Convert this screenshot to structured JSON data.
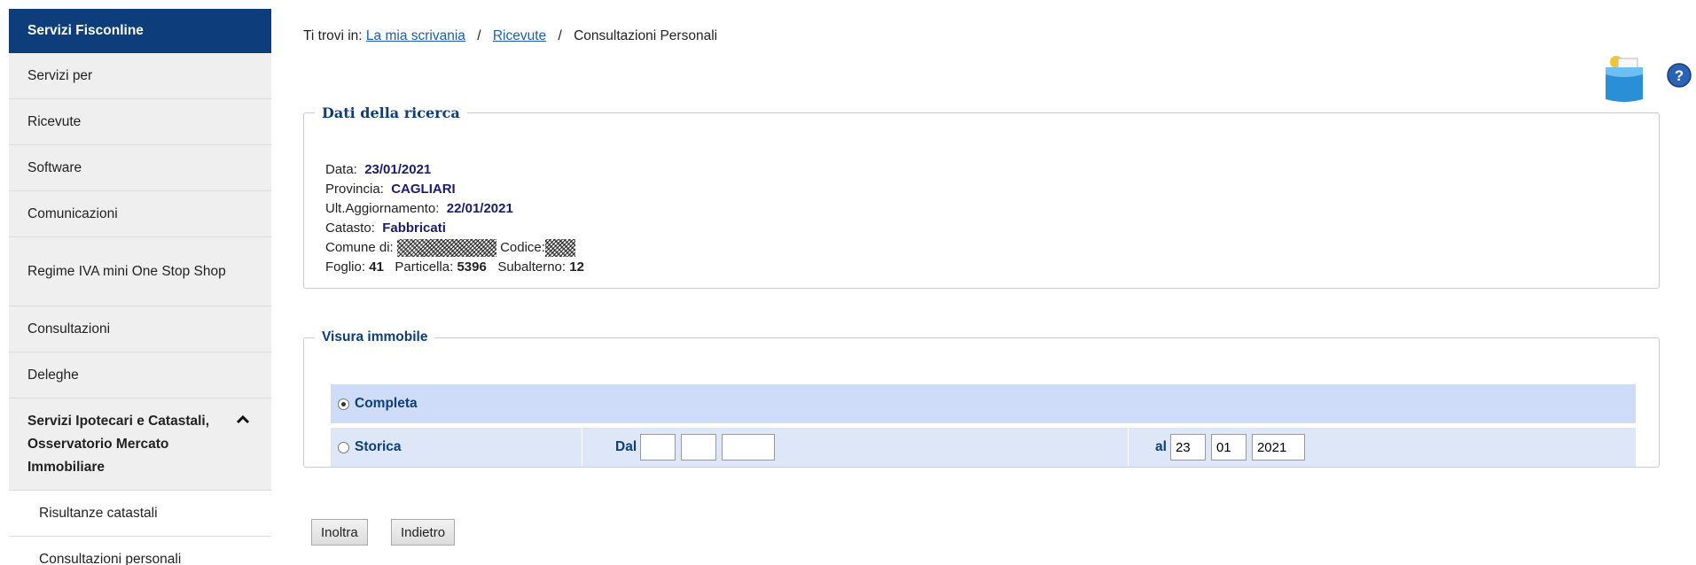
{
  "sidebar": {
    "header": "Servizi Fisconline",
    "items": [
      "Servizi per",
      "Ricevute",
      "Software",
      "Comunicazioni",
      "Regime IVA mini One Stop Shop",
      "Consultazioni",
      "Deleghe"
    ],
    "expanded_section": "Servizi Ipotecari e Catastali, Osservatorio Mercato Immobiliare",
    "sub_items": [
      "Risultanze catastali",
      "Consultazioni personali"
    ]
  },
  "breadcrumb": {
    "prefix": "Ti trovi in:",
    "links": [
      "La mia scrivania",
      "Ricevute"
    ],
    "separator": "/",
    "current": "Consultazioni Personali"
  },
  "ricerca": {
    "legend": "Dati della ricerca",
    "data_label": "Data:",
    "data_value": "23/01/2021",
    "provincia_label": "Provincia:",
    "provincia_value": "CAGLIARI",
    "agg_label": "Ult.Aggiornamento:",
    "agg_value": "22/01/2021",
    "catasto_label": "Catasto:",
    "catasto_value": "Fabbricati",
    "comune_label": "Comune di:",
    "codice_label": "Codice:",
    "foglio_label": "Foglio:",
    "foglio_value": "41",
    "particella_label": "Particella:",
    "particella_value": "5396",
    "subalterno_label": "Subalterno:",
    "subalterno_value": "12"
  },
  "visura": {
    "legend": "Visura immobile",
    "option_completa": "Completa",
    "option_storica": "Storica",
    "selected": "Completa",
    "dal_label": "Dal",
    "dal_values": [
      "",
      "",
      ""
    ],
    "al_label": "al",
    "al_day": "23",
    "al_month": "01",
    "al_year": "2021"
  },
  "buttons": {
    "inoltra": "Inoltra",
    "indietro": "Indietro"
  },
  "colors": {
    "sidebar_header": "#0d3d7a",
    "link": "#1a5fb4",
    "value": "#1b1b6e",
    "row_bg": "#dde7f8"
  }
}
